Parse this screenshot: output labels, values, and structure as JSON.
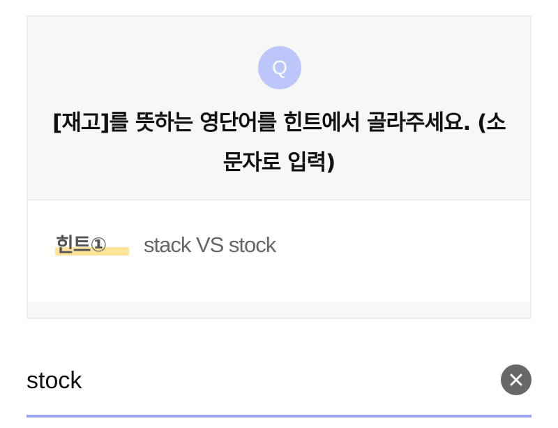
{
  "question": {
    "badge": "Q",
    "text": "[재고]를 뜻하는 영단어를 힌트에서 골라주세요. (소문자로 입력)"
  },
  "hint": {
    "label": "힌트①",
    "text": "stack VS stock"
  },
  "answer": {
    "value": "stock",
    "clear_icon": "close-icon"
  },
  "colors": {
    "badge": "#bcc6fb",
    "highlight": "#ffe49a",
    "underline": "#9aa6ee",
    "clear_button": "#676767"
  }
}
